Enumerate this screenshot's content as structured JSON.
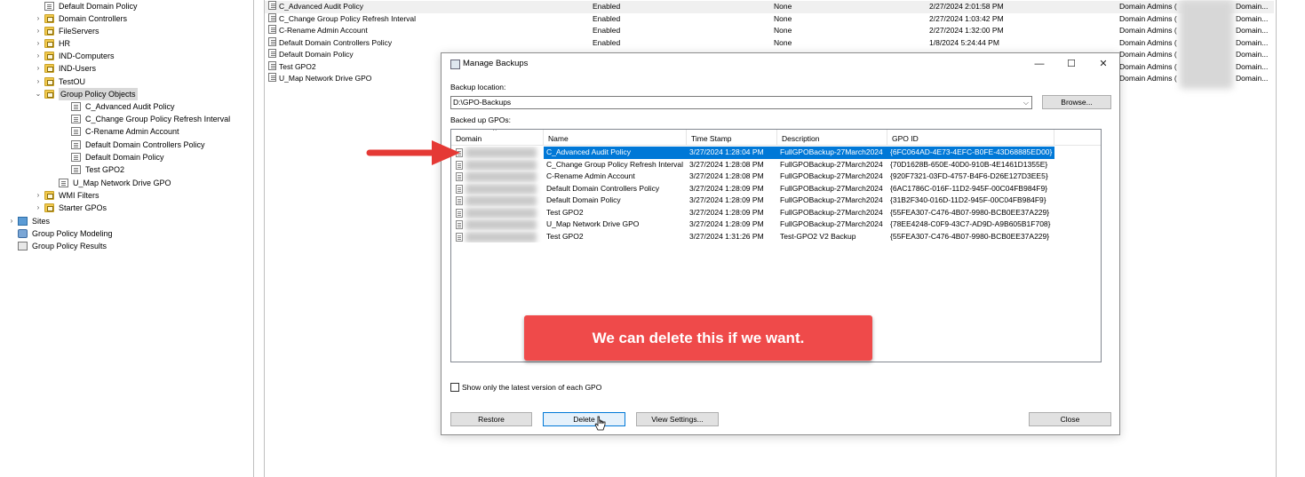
{
  "tree": {
    "items": [
      {
        "label": "Default Domain Policy",
        "icon": "doc-icon",
        "chev": ""
      },
      {
        "label": "Domain Controllers",
        "icon": "folder-icon",
        "chev": ">"
      },
      {
        "label": "FileServers",
        "icon": "folder-icon",
        "chev": ">"
      },
      {
        "label": "HR",
        "icon": "folder-icon",
        "chev": ">"
      },
      {
        "label": "IND-Computers",
        "icon": "folder-icon",
        "chev": ">"
      },
      {
        "label": "IND-Users",
        "icon": "folder-icon",
        "chev": ">"
      },
      {
        "label": "TestOU",
        "icon": "folder-icon",
        "chev": ">"
      },
      {
        "label": "Group Policy Objects",
        "icon": "folder-icon",
        "chev": "v"
      },
      {
        "label": "C_Advanced Audit Policy",
        "icon": "doc-icon",
        "chev": ""
      },
      {
        "label": "C_Change Group Policy Refresh Interval",
        "icon": "doc-icon",
        "chev": ""
      },
      {
        "label": "C-Rename Admin Account",
        "icon": "doc-icon",
        "chev": ""
      },
      {
        "label": "Default Domain Controllers Policy",
        "icon": "doc-icon",
        "chev": ""
      },
      {
        "label": "Default Domain Policy",
        "icon": "doc-icon",
        "chev": ""
      },
      {
        "label": "Test GPO2",
        "icon": "doc-icon",
        "chev": ""
      },
      {
        "label": "U_Map Network Drive GPO",
        "icon": "doc-icon",
        "chev": ""
      },
      {
        "label": "WMI Filters",
        "icon": "folder-icon",
        "chev": ">"
      },
      {
        "label": "Starter GPOs",
        "icon": "folder-icon",
        "chev": ">"
      },
      {
        "label": "Sites",
        "icon": "site-icon",
        "chev": ">"
      },
      {
        "label": "Group Policy Modeling",
        "icon": "modeling-icon",
        "chev": ""
      },
      {
        "label": "Group Policy Results",
        "icon": "results-icon",
        "chev": ""
      }
    ]
  },
  "gpo_list": {
    "rows": [
      {
        "name": "C_Advanced Audit Policy",
        "status": "Enabled",
        "wmi": "None",
        "modified": "2/27/2024 2:01:58 PM",
        "owner": "Domain Admins (",
        "owner2": "Domain..."
      },
      {
        "name": "C_Change Group Policy Refresh Interval",
        "status": "Enabled",
        "wmi": "None",
        "modified": "2/27/2024 1:03:42 PM",
        "owner": "Domain Admins (",
        "owner2": "Domain..."
      },
      {
        "name": "C-Rename Admin Account",
        "status": "Enabled",
        "wmi": "None",
        "modified": "2/27/2024 1:32:00 PM",
        "owner": "Domain Admins (",
        "owner2": "Domain..."
      },
      {
        "name": "Default Domain Controllers Policy",
        "status": "Enabled",
        "wmi": "None",
        "modified": "1/8/2024 5:24:44 PM",
        "owner": "Domain Admins (",
        "owner2": "Domain..."
      },
      {
        "name": "Default Domain Policy",
        "status": "",
        "wmi": "",
        "modified": "",
        "owner": "Domain Admins (",
        "owner2": "Domain..."
      },
      {
        "name": "Test GPO2",
        "status": "",
        "wmi": "",
        "modified": "",
        "owner": "Domain Admins (",
        "owner2": "Domain..."
      },
      {
        "name": "U_Map Network Drive GPO",
        "status": "",
        "wmi": "",
        "modified": "",
        "owner": "Domain Admins (",
        "owner2": "Domain..."
      }
    ]
  },
  "dialog": {
    "title": "Manage Backups",
    "minimize": "—",
    "maximize": "☐",
    "close": "✕",
    "backup_location_label": "Backup location:",
    "backup_location_value": "D:\\GPO-Backups",
    "browse_label": "Browse...",
    "backed_up_label": "Backed up GPOs:",
    "columns": [
      "Domain",
      "Name",
      "Time Stamp",
      "Description",
      "GPO ID"
    ],
    "rows": [
      {
        "name": "C_Advanced Audit Policy",
        "time": "3/27/2024 1:28:04 PM",
        "desc": "FullGPOBackup-27March2024",
        "id": "{6FC064AD-4E73-4EFC-B0FE-43D68885ED00}",
        "selected": true
      },
      {
        "name": "C_Change Group Policy Refresh Interval",
        "time": "3/27/2024 1:28:08 PM",
        "desc": "FullGPOBackup-27March2024",
        "id": "{70D1628B-650E-40D0-910B-4E1461D1355E}",
        "selected": false
      },
      {
        "name": "C-Rename Admin Account",
        "time": "3/27/2024 1:28:08 PM",
        "desc": "FullGPOBackup-27March2024",
        "id": "{920F7321-03FD-4757-B4F6-D26E127D3EE5}",
        "selected": false
      },
      {
        "name": "Default Domain Controllers Policy",
        "time": "3/27/2024 1:28:09 PM",
        "desc": "FullGPOBackup-27March2024",
        "id": "{6AC1786C-016F-11D2-945F-00C04FB984F9}",
        "selected": false
      },
      {
        "name": "Default Domain Policy",
        "time": "3/27/2024 1:28:09 PM",
        "desc": "FullGPOBackup-27March2024",
        "id": "{31B2F340-016D-11D2-945F-00C04FB984F9}",
        "selected": false
      },
      {
        "name": "Test GPO2",
        "time": "3/27/2024 1:28:09 PM",
        "desc": "FullGPOBackup-27March2024",
        "id": "{55FEA307-C476-4B07-9980-BCB0EE37A229}",
        "selected": false
      },
      {
        "name": "U_Map Network Drive GPO",
        "time": "3/27/2024 1:28:09 PM",
        "desc": "FullGPOBackup-27March2024",
        "id": "{78EE4248-C0F9-43C7-AD9D-A9B605B1F708}",
        "selected": false
      },
      {
        "name": "Test GPO2",
        "time": "3/27/2024 1:31:26 PM",
        "desc": "Test-GPO2 V2 Backup",
        "id": "{55FEA307-C476-4B07-9980-BCB0EE37A229}",
        "selected": false
      }
    ],
    "checkbox_label": "Show only the latest version of each GPO",
    "restore_label": "Restore",
    "delete_label": "Delete",
    "view_settings_label": "View Settings...",
    "close_label": "Close"
  },
  "callout": {
    "text": "We can delete this if we want.",
    "color": "#ef4a4a"
  },
  "colors": {
    "selection": "#0078d7",
    "arrow": "#e53935"
  }
}
